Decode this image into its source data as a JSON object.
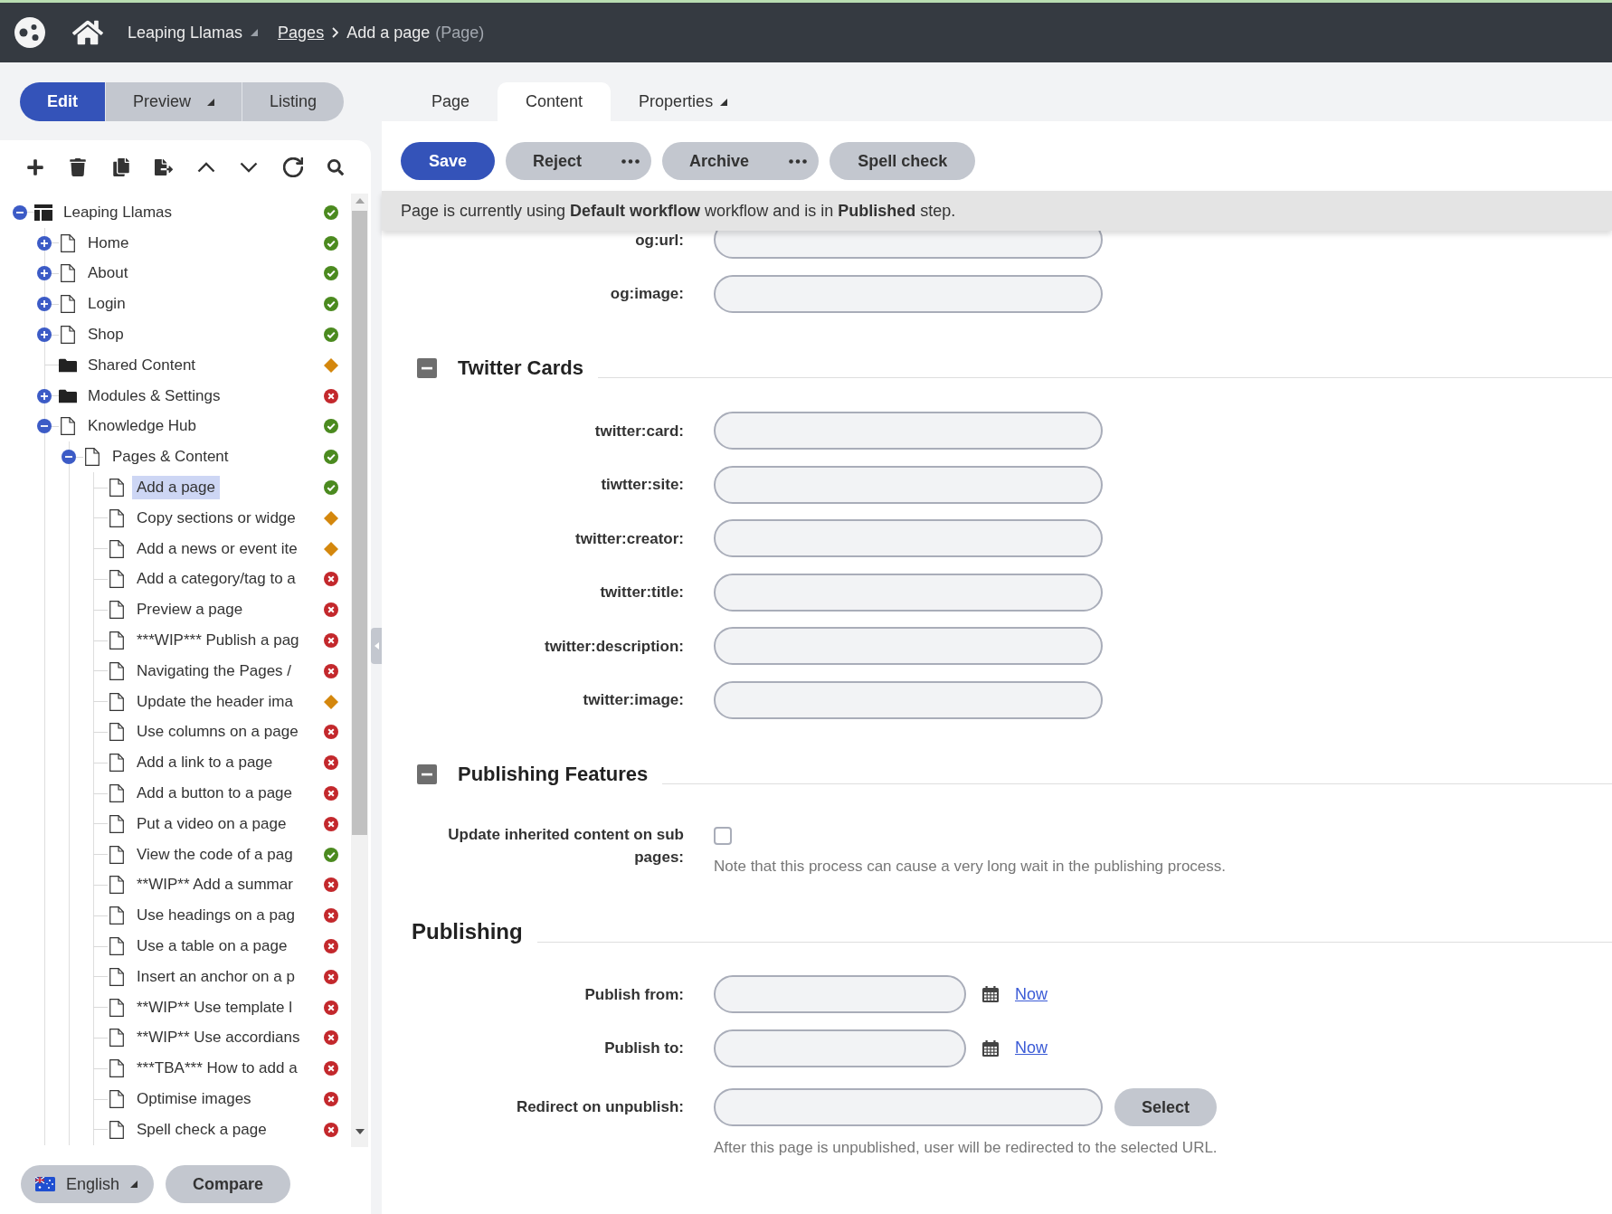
{
  "top_bar": {
    "breadcrumbs": [
      {
        "label": "Leaping Llamas",
        "kind": "menu"
      },
      {
        "label": "Pages",
        "kind": "link"
      },
      {
        "label": "Add a page",
        "kind": "current",
        "suffix": "(Page)"
      }
    ]
  },
  "view_modes": [
    {
      "label": "Edit",
      "selected": true,
      "dropdown": false
    },
    {
      "label": "Preview",
      "selected": false,
      "dropdown": true
    },
    {
      "label": "Listing",
      "selected": false,
      "dropdown": false
    }
  ],
  "tree": [
    {
      "label": "Leaping Llamas",
      "kind": "site",
      "status": {
        "kind": "check"
      },
      "selected": false,
      "expanded": true,
      "children": [
        {
          "label": "Home",
          "kind": "page",
          "status": {
            "kind": "check"
          },
          "selected": false,
          "expanded": false
        },
        {
          "label": "About",
          "kind": "page",
          "status": {
            "kind": "check"
          },
          "selected": false,
          "expanded": false
        },
        {
          "label": "Login",
          "kind": "page",
          "status": {
            "kind": "check"
          },
          "selected": false,
          "expanded": false
        },
        {
          "label": "Shop",
          "kind": "page",
          "status": {
            "kind": "check"
          },
          "selected": false,
          "expanded": false
        },
        {
          "label": "Shared Content",
          "kind": "folder",
          "status": {
            "kind": "diamond"
          },
          "selected": false
        },
        {
          "label": "Modules & Settings",
          "kind": "folder",
          "status": {
            "kind": "cross"
          },
          "selected": false,
          "expanded": false
        },
        {
          "label": "Knowledge Hub",
          "kind": "page",
          "status": {
            "kind": "check"
          },
          "selected": false,
          "expanded": true,
          "children": [
            {
              "label": "Pages & Content",
              "kind": "page",
              "status": {
                "kind": "check"
              },
              "selected": false,
              "expanded": true,
              "children": [
                {
                  "label": "Add a page",
                  "kind": "page",
                  "status": {
                    "kind": "check"
                  },
                  "selected": true
                },
                {
                  "label": "Copy sections or widge",
                  "kind": "page",
                  "status": {
                    "kind": "diamond"
                  },
                  "selected": false
                },
                {
                  "label": "Add a news or event ite",
                  "kind": "page",
                  "status": {
                    "kind": "diamond"
                  },
                  "selected": false
                },
                {
                  "label": "Add a category/tag to a",
                  "kind": "page",
                  "status": {
                    "kind": "cross"
                  },
                  "selected": false
                },
                {
                  "label": "Preview a page",
                  "kind": "page",
                  "status": {
                    "kind": "cross"
                  },
                  "selected": false
                },
                {
                  "label": "***WIP*** Publish a pag",
                  "kind": "page",
                  "status": {
                    "kind": "cross"
                  },
                  "selected": false
                },
                {
                  "label": "Navigating the Pages /",
                  "kind": "page",
                  "status": {
                    "kind": "cross"
                  },
                  "selected": false
                },
                {
                  "label": "Update the header ima",
                  "kind": "page",
                  "status": {
                    "kind": "diamond"
                  },
                  "selected": false
                },
                {
                  "label": "Use columns on a page",
                  "kind": "page",
                  "status": {
                    "kind": "cross"
                  },
                  "selected": false
                },
                {
                  "label": "Add a link to a page",
                  "kind": "page",
                  "status": {
                    "kind": "cross"
                  },
                  "selected": false
                },
                {
                  "label": "Add a button to a page",
                  "kind": "page",
                  "status": {
                    "kind": "cross"
                  },
                  "selected": false
                },
                {
                  "label": "Put a video on a page",
                  "kind": "page",
                  "status": {
                    "kind": "cross"
                  },
                  "selected": false
                },
                {
                  "label": "View the code of a pag",
                  "kind": "page",
                  "status": {
                    "kind": "check"
                  },
                  "selected": false
                },
                {
                  "label": "**WIP** Add a summar",
                  "kind": "page",
                  "status": {
                    "kind": "cross"
                  },
                  "selected": false
                },
                {
                  "label": "Use headings on a pag",
                  "kind": "page",
                  "status": {
                    "kind": "cross"
                  },
                  "selected": false
                },
                {
                  "label": "Use a table on a page",
                  "kind": "page",
                  "status": {
                    "kind": "cross"
                  },
                  "selected": false
                },
                {
                  "label": "Insert an anchor on a p",
                  "kind": "page",
                  "status": {
                    "kind": "cross"
                  },
                  "selected": false
                },
                {
                  "label": "**WIP** Use template l",
                  "kind": "page",
                  "status": {
                    "kind": "cross"
                  },
                  "selected": false
                },
                {
                  "label": "**WIP** Use accordians",
                  "kind": "page",
                  "status": {
                    "kind": "cross"
                  },
                  "selected": false
                },
                {
                  "label": "***TBA*** How to add a",
                  "kind": "page",
                  "status": {
                    "kind": "cross"
                  },
                  "selected": false
                },
                {
                  "label": "Optimise images",
                  "kind": "page",
                  "status": {
                    "kind": "cross"
                  },
                  "selected": false
                },
                {
                  "label": "Spell check a page",
                  "kind": "page",
                  "status": {
                    "kind": "cross"
                  },
                  "selected": false
                }
              ]
            }
          ]
        }
      ]
    }
  ],
  "footer": {
    "language": {
      "label": "English"
    },
    "compare": {
      "label": "Compare"
    }
  },
  "editor_tabs": [
    {
      "label": "Page",
      "selected": false,
      "dropdown": false
    },
    {
      "label": "Content",
      "selected": true,
      "dropdown": false
    },
    {
      "label": "Properties",
      "selected": false,
      "dropdown": true
    }
  ],
  "actions": [
    {
      "label": "Save",
      "kind": "primary"
    },
    {
      "label": "Reject",
      "kind": "split"
    },
    {
      "label": "Archive",
      "kind": "split"
    },
    {
      "label": "Spell check",
      "kind": "plain"
    }
  ],
  "workflow_notice": "Page is currently using **Default workflow** workflow and is in **Published** step.",
  "fields": [
    {
      "kind": "text",
      "label": "og:url:"
    },
    {
      "kind": "text",
      "label": "og:image:"
    }
  ],
  "sections": [
    {
      "kind": "collapsible",
      "title": "Twitter Cards",
      "expanded": true,
      "fields": [
        {
          "kind": "text",
          "label": "twitter:card:"
        },
        {
          "kind": "text",
          "label": "tiwtter:site:"
        },
        {
          "kind": "text",
          "label": "twitter:creator:"
        },
        {
          "kind": "text",
          "label": "twitter:title:"
        },
        {
          "kind": "text",
          "label": "twitter:description:"
        },
        {
          "kind": "text",
          "label": "twitter:image:"
        }
      ]
    },
    {
      "kind": "collapsible",
      "title": "Publishing Features",
      "expanded": true,
      "fields": [
        {
          "kind": "checkbox",
          "label": "Update inherited content on sub pages:",
          "checked": false,
          "note": "Note that this process can cause a very long wait in the publishing process."
        }
      ]
    },
    {
      "kind": "heading",
      "title": "Publishing",
      "fields": [
        {
          "kind": "date",
          "label": "Publish from:",
          "link": "Now"
        },
        {
          "kind": "date",
          "label": "Publish to:",
          "link": "Now"
        },
        {
          "kind": "url",
          "label": "Redirect on unpublish:",
          "button": "Select",
          "note": "After this page is unpublished, user will be redirected to the selected URL."
        }
      ]
    }
  ]
}
